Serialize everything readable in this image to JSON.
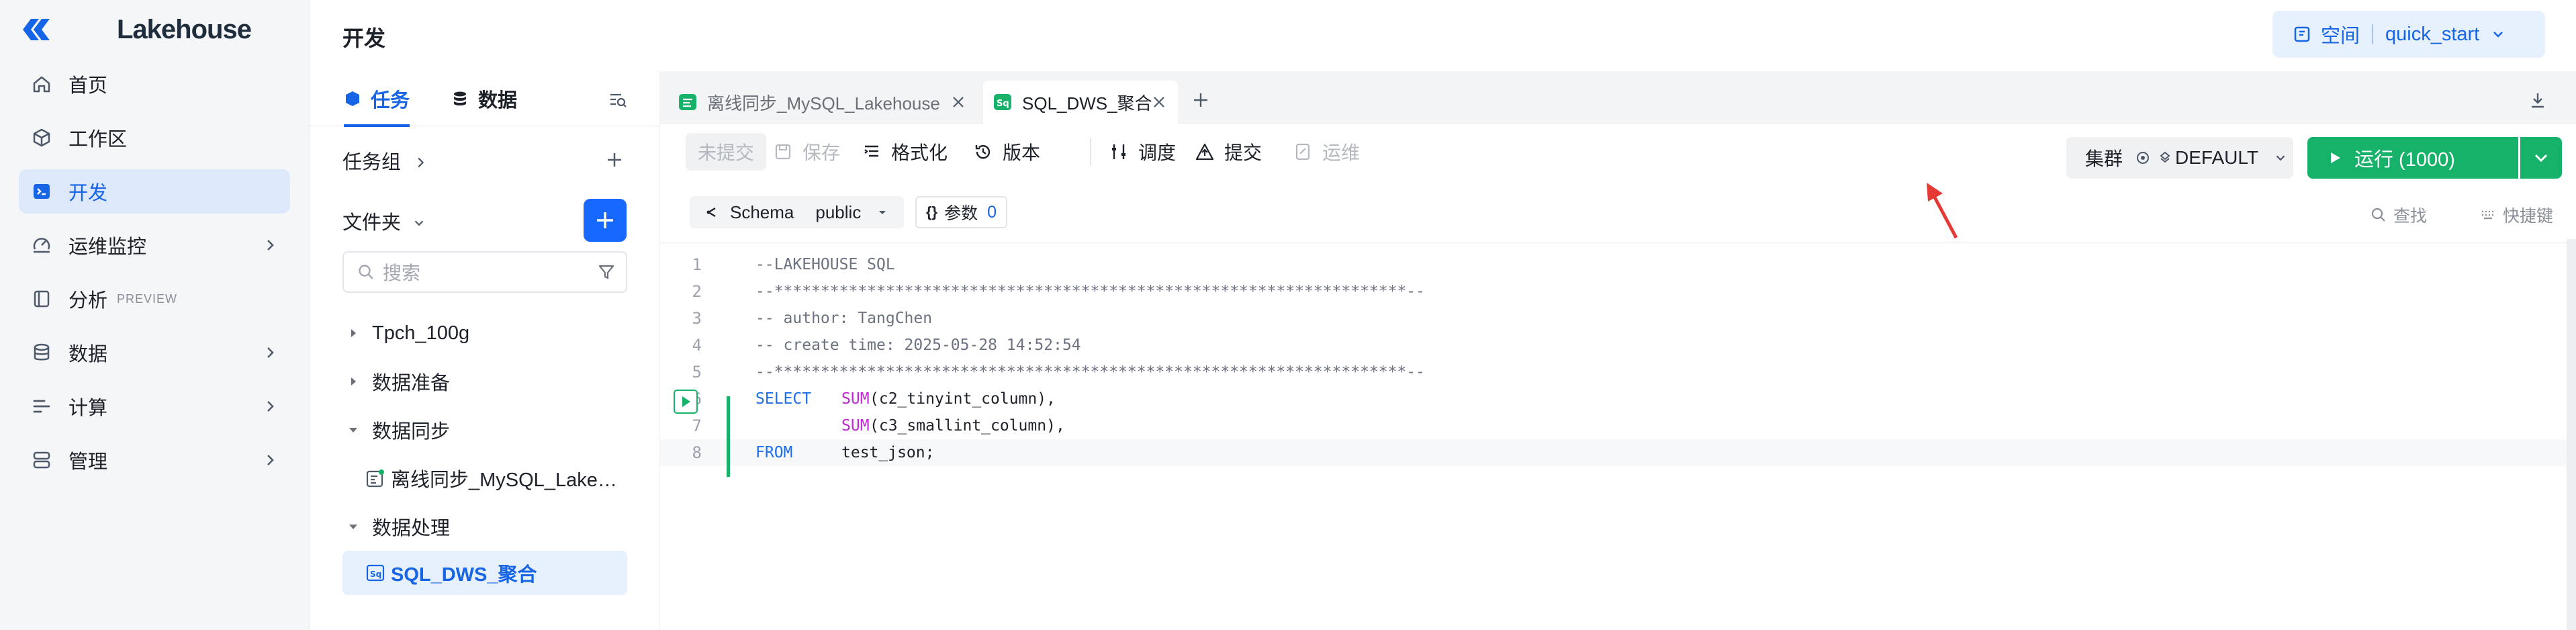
{
  "brand": {
    "name": "Lakehouse",
    "color": "#1665e6"
  },
  "nav": {
    "items": [
      {
        "label": "首页",
        "icon": "home-icon",
        "active": false,
        "expandable": false
      },
      {
        "label": "工作区",
        "icon": "cube-icon",
        "active": false,
        "expandable": false
      },
      {
        "label": "开发",
        "icon": "terminal-icon",
        "active": true,
        "expandable": false
      },
      {
        "label": "运维监控",
        "icon": "monitor-icon",
        "active": false,
        "expandable": true
      },
      {
        "label": "分析",
        "badge": "PREVIEW",
        "icon": "book-icon",
        "active": false,
        "expandable": false
      },
      {
        "label": "数据",
        "icon": "database-icon",
        "active": false,
        "expandable": true
      },
      {
        "label": "计算",
        "icon": "compute-icon",
        "active": false,
        "expandable": true
      },
      {
        "label": "管理",
        "icon": "server-icon",
        "active": false,
        "expandable": true
      }
    ]
  },
  "header": {
    "title": "开发",
    "space_label": "空间",
    "space_value": "quick_start"
  },
  "task_panel": {
    "tab_tasks": "任务",
    "tab_data": "数据",
    "task_group": "任务组",
    "folder": "文件夹",
    "search_placeholder": "搜索",
    "tree": [
      {
        "label": "Tpch_100g",
        "type": "folder",
        "expanded": false
      },
      {
        "label": "数据准备",
        "type": "folder",
        "expanded": false
      },
      {
        "label": "数据同步",
        "type": "folder",
        "expanded": true
      },
      {
        "label": "离线同步_MySQL_Lake…",
        "type": "sync-task"
      },
      {
        "label": "数据处理",
        "type": "folder",
        "expanded": true
      },
      {
        "label": "SQL_DWS_聚合",
        "type": "sql-task",
        "selected": true
      }
    ]
  },
  "file_tabs": [
    {
      "label": "离线同步_MySQL_Lakehouse",
      "active": false
    },
    {
      "label": "SQL_DWS_聚合",
      "active": true
    }
  ],
  "toolbar": {
    "uncommitted": "未提交",
    "save": "保存",
    "format": "格式化",
    "version": "版本",
    "schedule": "调度",
    "submit": "提交",
    "ops": "运维",
    "cluster_label": "集群",
    "cluster_value": "DEFAULT",
    "run_label": "运行 (1000)"
  },
  "schema_bar": {
    "schema_label": "Schema",
    "schema_value": "public",
    "params_label": "参数",
    "params_count": "0",
    "find": "查找",
    "shortcuts": "快捷键"
  },
  "code": {
    "lines": [
      {
        "n": "1",
        "text": "--LAKEHOUSE SQL"
      },
      {
        "n": "2",
        "text": "--********************************************************************--"
      },
      {
        "n": "3",
        "text": "-- author: TangChen"
      },
      {
        "n": "4",
        "text": "-- create time: 2025-05-28 14:52:54"
      },
      {
        "n": "5",
        "text": "--********************************************************************--"
      },
      {
        "n": "6",
        "kw": "SELECT",
        "fn": "SUM",
        "rest": "(c2_tinyint_column),"
      },
      {
        "n": "7",
        "kw": "",
        "fn": "SUM",
        "rest": "(c3_smallint_column),"
      },
      {
        "n": "8",
        "kw": "FROM",
        "fn": "",
        "rest": "test_json;"
      }
    ]
  },
  "colors": {
    "run_green": "#17b26a",
    "active_blue": "#1665e6",
    "annotation_red": "#e53935"
  }
}
